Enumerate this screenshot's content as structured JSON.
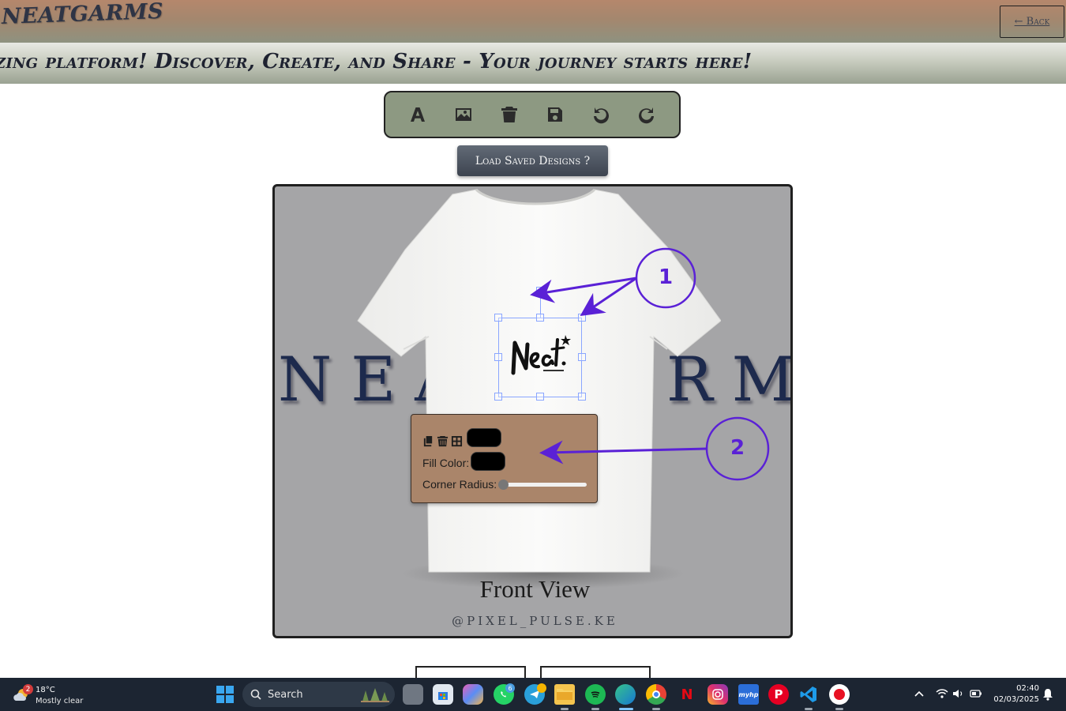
{
  "header": {
    "brand": "NEATGARMS",
    "back_label": "← Back",
    "marquee": "zing platform! Discover, Create, and Share - Your journey starts here!"
  },
  "toolbar": {
    "tools": [
      {
        "name": "text-tool",
        "icon": "text-icon"
      },
      {
        "name": "image-tool",
        "icon": "image-icon"
      },
      {
        "name": "delete-tool",
        "icon": "trash-icon"
      },
      {
        "name": "save-tool",
        "icon": "save-icon"
      },
      {
        "name": "undo-tool",
        "icon": "undo-icon"
      },
      {
        "name": "redo-tool",
        "icon": "redo-icon"
      }
    ],
    "load_saved_label": "Load Saved Designs ?"
  },
  "canvas": {
    "watermark": "NEATGARMS",
    "view_label": "Front View",
    "credit": "@PIXEL_PULSE.KE",
    "background_color": "#a5a5a7",
    "selected_element": "neat-logo-image"
  },
  "properties_panel": {
    "icons": [
      "copy-icon",
      "trash-icon",
      "grid-icon"
    ],
    "stroke_color": "#000000",
    "fill_label": "Fill Color:",
    "fill_color": "#000000",
    "radius_label": "Corner Radius:",
    "corner_radius_value": 0
  },
  "annotations": {
    "marker_1": "1",
    "marker_2": "2",
    "color": "#5a21d6"
  },
  "taskbar": {
    "weather_temp": "18°C",
    "weather_desc": "Mostly clear",
    "weather_badge": "2",
    "search_label": "Search",
    "apps": [
      "file-explorer-gray",
      "ms-store",
      "copilot",
      "whatsapp",
      "telegram",
      "file-explorer",
      "spotify",
      "edge",
      "chrome",
      "netflix",
      "instagram",
      "myhp",
      "pinterest",
      "vscode",
      "recorder"
    ],
    "whatsapp_badge": "6",
    "time": "02:40",
    "date": "02/03/2025"
  }
}
